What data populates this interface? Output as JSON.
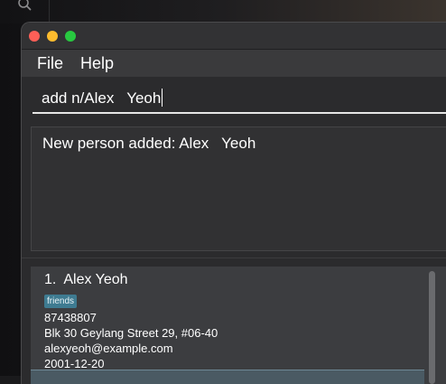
{
  "menu": {
    "file_label": "File",
    "help_label": "Help"
  },
  "command": {
    "value": "add n/Alex   Yeoh"
  },
  "result": {
    "message": "New person added: Alex   Yeoh"
  },
  "person_list": [
    {
      "index_name": "1.  Alex Yeoh",
      "tags": [
        "friends"
      ],
      "phone": "87438807",
      "address": "Blk 30 Geylang Street 29, #06-40",
      "email": "alexyeoh@example.com",
      "birthday": "2001-12-20"
    }
  ],
  "colors": {
    "tag_background": "#3e7b91",
    "window_background": "#2b2b2d",
    "card_background": "#3c3d40"
  },
  "icons": {
    "desktop_search": "search-icon"
  }
}
